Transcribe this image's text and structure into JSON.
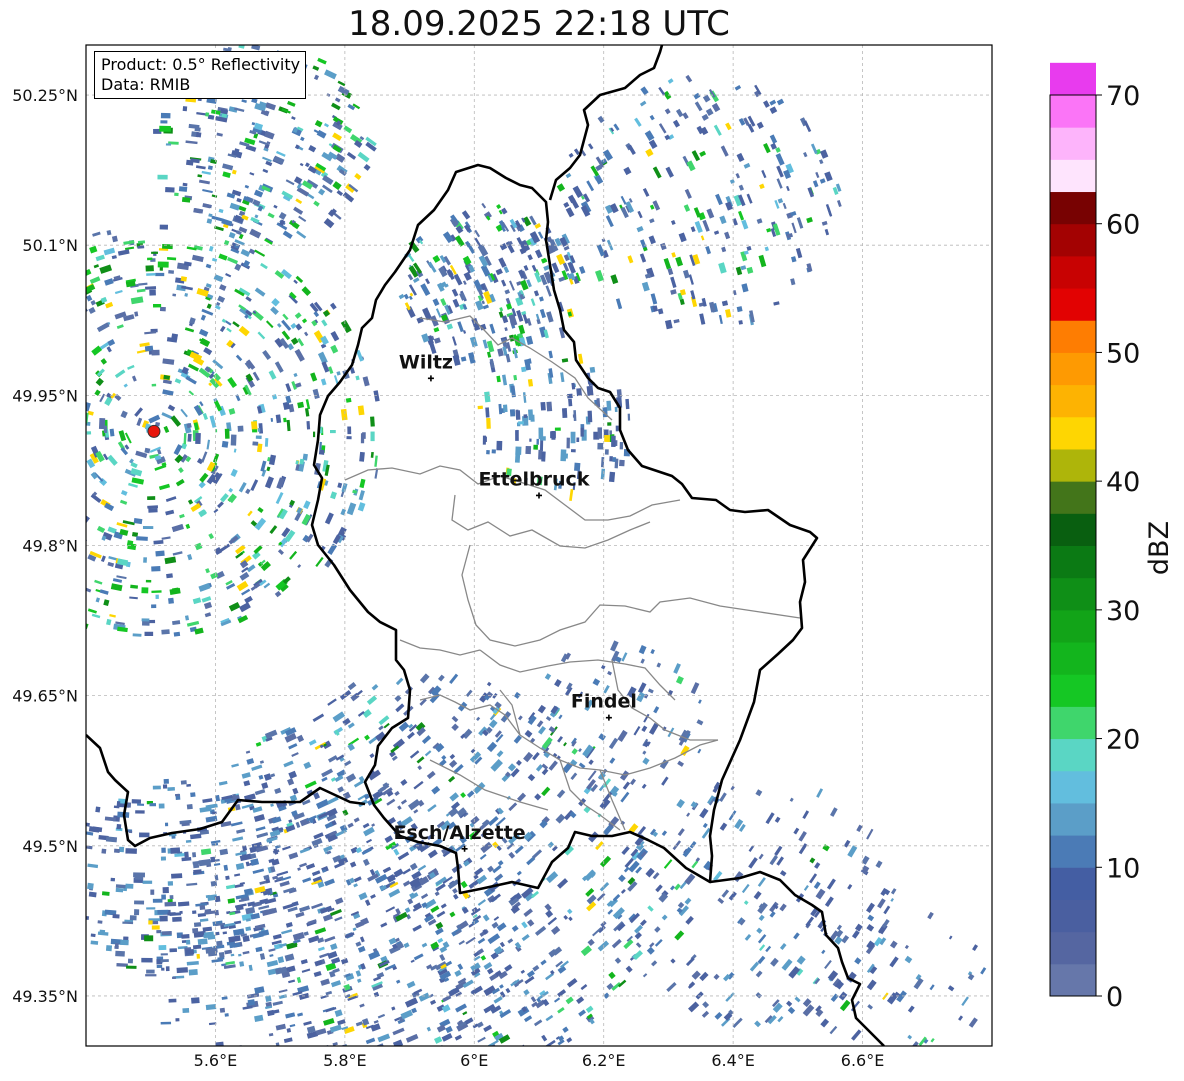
{
  "title": "18.09.2025 22:18 UTC",
  "info": {
    "product": "Product: 0.5° Reflectivity",
    "data": "Data: RMIB"
  },
  "map_extent": {
    "lon_min": 5.4,
    "lon_max": 6.8,
    "lat_min": 49.3,
    "lat_max": 50.3
  },
  "lon_ticks": [
    {
      "value": 5.6,
      "label": "5.6°E"
    },
    {
      "value": 5.8,
      "label": "5.8°E"
    },
    {
      "value": 6.0,
      "label": "6°E"
    },
    {
      "value": 6.2,
      "label": "6.2°E"
    },
    {
      "value": 6.4,
      "label": "6.4°E"
    },
    {
      "value": 6.6,
      "label": "6.6°E"
    }
  ],
  "lat_ticks": [
    {
      "value": 50.25,
      "label": "50.25°N"
    },
    {
      "value": 50.1,
      "label": "50.1°N"
    },
    {
      "value": 49.95,
      "label": "49.95°N"
    },
    {
      "value": 49.8,
      "label": "49.8°N"
    },
    {
      "value": 49.65,
      "label": "49.65°N"
    },
    {
      "value": 49.5,
      "label": "49.5°N"
    },
    {
      "value": 49.35,
      "label": "49.35°N"
    }
  ],
  "radar_site": {
    "lon": 5.505,
    "lat": 49.914,
    "color": "#e8160c"
  },
  "cities": [
    {
      "name": "Wiltz",
      "lon": 5.933,
      "lat": 49.967
    },
    {
      "name": "Ettelbruck",
      "lon": 6.1,
      "lat": 49.85
    },
    {
      "name": "Findel",
      "lon": 6.208,
      "lat": 49.628
    },
    {
      "name": "Esch/Alzette",
      "lon": 5.985,
      "lat": 49.497
    }
  ],
  "colorbar": {
    "label": "dBZ",
    "min": 0,
    "max": 70,
    "step": 2.5,
    "ticks": [
      0,
      10,
      20,
      30,
      40,
      50,
      60,
      70
    ],
    "colors": [
      "#6677aa",
      "#5566a1",
      "#4a5fa0",
      "#445ea3",
      "#4b7bb6",
      "#5b9ec8",
      "#62bede",
      "#5ad6c4",
      "#3fd66c",
      "#15c724",
      "#13b51d",
      "#12a418",
      "#0f8f17",
      "#0b7a14",
      "#095f10",
      "#43751a",
      "#aeb50a",
      "#fed602",
      "#fdb302",
      "#fe9a02",
      "#fe7d02",
      "#e20202",
      "#c80202",
      "#a30202",
      "#780202",
      "#fee4fd",
      "#fdb4fb",
      "#fb75f7",
      "#e83bee"
    ]
  },
  "colors": {
    "border": "#000000",
    "admin": "#888888",
    "grid": "#b8b8b8"
  }
}
